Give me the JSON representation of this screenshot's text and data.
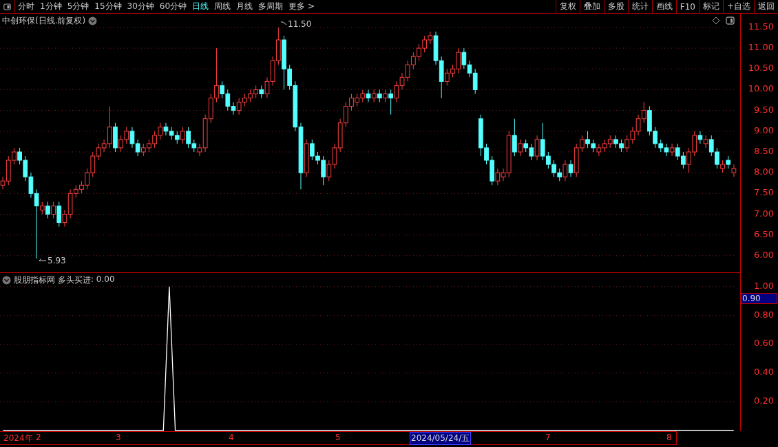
{
  "toolbar": {
    "periods": [
      {
        "label": "分时",
        "selected": false
      },
      {
        "label": "1分钟",
        "selected": false
      },
      {
        "label": "5分钟",
        "selected": false
      },
      {
        "label": "15分钟",
        "selected": false
      },
      {
        "label": "30分钟",
        "selected": false
      },
      {
        "label": "60分钟",
        "selected": false
      },
      {
        "label": "日线",
        "selected": true
      },
      {
        "label": "周线",
        "selected": false
      },
      {
        "label": "月线",
        "selected": false
      },
      {
        "label": "多周期",
        "selected": false
      },
      {
        "label": "更多 >",
        "selected": false
      }
    ],
    "actions": [
      "复权",
      "叠加",
      "多股",
      "统计",
      "画线",
      "F10",
      "标记",
      "+自选",
      "返回"
    ]
  },
  "price_pane": {
    "title": "中创环保(日线.前复权)",
    "high_label": "11.50",
    "low_label": "5.93",
    "chart_data": {
      "type": "candlestick",
      "grid": true,
      "ylim": [
        5.6,
        11.83
      ],
      "yticks": [
        {
          "value": 11.5,
          "label": "11.50"
        },
        {
          "value": 11,
          "label": "11.00"
        },
        {
          "value": 10.5,
          "label": "10.50"
        },
        {
          "value": 10,
          "label": "10.00"
        },
        {
          "value": 9.5,
          "label": "9.50"
        },
        {
          "value": 9,
          "label": "9.00"
        },
        {
          "value": 8.5,
          "label": "8.50"
        },
        {
          "value": 8,
          "label": "8.00"
        },
        {
          "value": 7.5,
          "label": "7.50"
        },
        {
          "value": 7,
          "label": "7.00"
        },
        {
          "value": 6.5,
          "label": "6.50"
        },
        {
          "value": 6,
          "label": "6.00"
        }
      ],
      "ohlc": [
        [
          7.7,
          7.9,
          7.6,
          7.8
        ],
        [
          7.8,
          8.4,
          7.7,
          8.3
        ],
        [
          8.3,
          8.6,
          8.2,
          8.5
        ],
        [
          8.5,
          8.6,
          8.2,
          8.3
        ],
        [
          8.3,
          8.4,
          7.8,
          7.9
        ],
        [
          7.9,
          8.0,
          7.4,
          7.5
        ],
        [
          7.5,
          7.6,
          5.93,
          7.2
        ],
        [
          7.1,
          7.3,
          7.0,
          7.2
        ],
        [
          7.2,
          7.3,
          6.9,
          7.0
        ],
        [
          7.0,
          7.3,
          6.9,
          7.2
        ],
        [
          7.2,
          7.3,
          6.7,
          6.8
        ],
        [
          6.8,
          7.1,
          6.7,
          7.0
        ],
        [
          7.0,
          7.6,
          6.9,
          7.5
        ],
        [
          7.5,
          7.7,
          7.4,
          7.6
        ],
        [
          7.6,
          7.8,
          7.5,
          7.7
        ],
        [
          7.7,
          8.1,
          7.6,
          8.0
        ],
        [
          8.0,
          8.5,
          7.9,
          8.4
        ],
        [
          8.4,
          8.7,
          8.3,
          8.6
        ],
        [
          8.6,
          8.8,
          8.5,
          8.7
        ],
        [
          8.7,
          9.6,
          8.6,
          9.1
        ],
        [
          9.1,
          9.2,
          8.5,
          8.6
        ],
        [
          8.6,
          8.9,
          8.5,
          8.8
        ],
        [
          8.8,
          9.1,
          8.7,
          9.0
        ],
        [
          9.0,
          9.1,
          8.6,
          8.7
        ],
        [
          8.7,
          8.8,
          8.4,
          8.5
        ],
        [
          8.5,
          8.7,
          8.4,
          8.6
        ],
        [
          8.6,
          8.8,
          8.5,
          8.7
        ],
        [
          8.7,
          9.0,
          8.6,
          8.9
        ],
        [
          8.9,
          9.2,
          8.8,
          9.1
        ],
        [
          9.1,
          9.2,
          8.9,
          9.0
        ],
        [
          9.0,
          9.1,
          8.8,
          8.9
        ],
        [
          8.9,
          9.0,
          8.7,
          8.8
        ],
        [
          8.8,
          9.1,
          8.7,
          9.0
        ],
        [
          9.0,
          9.1,
          8.6,
          8.7
        ],
        [
          8.7,
          8.8,
          8.5,
          8.6
        ],
        [
          8.5,
          8.7,
          8.4,
          8.6
        ],
        [
          8.6,
          9.4,
          8.5,
          9.3
        ],
        [
          9.3,
          9.9,
          9.2,
          9.8
        ],
        [
          9.8,
          11.0,
          9.7,
          10.1
        ],
        [
          10.1,
          10.2,
          9.8,
          9.9
        ],
        [
          9.9,
          10.0,
          9.5,
          9.6
        ],
        [
          9.6,
          9.7,
          9.4,
          9.5
        ],
        [
          9.5,
          9.8,
          9.4,
          9.7
        ],
        [
          9.7,
          9.9,
          9.6,
          9.8
        ],
        [
          9.8,
          10.0,
          9.7,
          9.9
        ],
        [
          9.9,
          10.1,
          9.8,
          10.0
        ],
        [
          10.0,
          10.1,
          9.8,
          9.9
        ],
        [
          9.9,
          10.3,
          9.8,
          10.2
        ],
        [
          10.2,
          10.8,
          10.1,
          10.7
        ],
        [
          10.7,
          11.5,
          10.6,
          11.2
        ],
        [
          11.2,
          11.3,
          10.0,
          10.5
        ],
        [
          10.5,
          10.6,
          10.0,
          10.1
        ],
        [
          10.1,
          10.2,
          9.0,
          9.1
        ],
        [
          9.1,
          9.2,
          7.6,
          8.0
        ],
        [
          8.0,
          8.8,
          7.9,
          8.7
        ],
        [
          8.7,
          8.8,
          8.3,
          8.4
        ],
        [
          8.4,
          8.5,
          8.2,
          8.3
        ],
        [
          8.3,
          8.4,
          7.7,
          7.9
        ],
        [
          7.9,
          8.3,
          7.8,
          8.2
        ],
        [
          8.2,
          8.7,
          8.1,
          8.6
        ],
        [
          8.6,
          9.3,
          8.5,
          9.2
        ],
        [
          9.2,
          9.7,
          9.1,
          9.6
        ],
        [
          9.6,
          9.9,
          9.5,
          9.8
        ],
        [
          9.7,
          9.9,
          9.6,
          9.8
        ],
        [
          9.8,
          10.0,
          9.7,
          9.9
        ],
        [
          9.9,
          10.0,
          9.7,
          9.8
        ],
        [
          9.8,
          10.0,
          9.7,
          9.9
        ],
        [
          9.9,
          10.0,
          9.7,
          9.8
        ],
        [
          9.8,
          10.0,
          9.7,
          9.9
        ],
        [
          9.9,
          10.0,
          9.4,
          9.8
        ],
        [
          9.8,
          10.2,
          9.7,
          10.1
        ],
        [
          10.1,
          10.4,
          10.0,
          10.3
        ],
        [
          10.3,
          10.7,
          10.2,
          10.6
        ],
        [
          10.6,
          10.9,
          10.5,
          10.8
        ],
        [
          10.8,
          11.1,
          10.7,
          11.0
        ],
        [
          11.0,
          11.3,
          10.9,
          11.2
        ],
        [
          11.2,
          11.4,
          11.1,
          11.3
        ],
        [
          11.3,
          11.4,
          10.6,
          10.7
        ],
        [
          10.7,
          10.8,
          9.8,
          10.2
        ],
        [
          10.2,
          10.5,
          10.1,
          10.4
        ],
        [
          10.4,
          10.6,
          10.3,
          10.5
        ],
        [
          10.5,
          11.0,
          10.4,
          10.9
        ],
        [
          10.9,
          11.0,
          10.5,
          10.6
        ],
        [
          10.6,
          10.7,
          10.3,
          10.4
        ],
        [
          10.4,
          10.5,
          9.9,
          10.0
        ],
        [
          9.3,
          9.4,
          8.4,
          8.6
        ],
        [
          8.6,
          8.7,
          8.2,
          8.3
        ],
        [
          8.3,
          8.4,
          7.7,
          7.8
        ],
        [
          7.8,
          8.1,
          7.7,
          8.0
        ],
        [
          7.9,
          8.1,
          7.8,
          8.0
        ],
        [
          8.0,
          9.0,
          7.9,
          8.9
        ],
        [
          8.9,
          9.3,
          8.4,
          8.5
        ],
        [
          8.5,
          8.8,
          8.4,
          8.7
        ],
        [
          8.7,
          8.8,
          8.5,
          8.6
        ],
        [
          8.6,
          8.7,
          8.3,
          8.4
        ],
        [
          8.4,
          8.9,
          8.3,
          8.8
        ],
        [
          8.8,
          9.2,
          8.3,
          8.4
        ],
        [
          8.4,
          8.5,
          8.1,
          8.2
        ],
        [
          8.2,
          8.3,
          7.9,
          8.0
        ],
        [
          8.0,
          8.1,
          7.8,
          7.9
        ],
        [
          7.9,
          8.3,
          7.8,
          8.2
        ],
        [
          8.2,
          8.3,
          7.9,
          8.0
        ],
        [
          8.0,
          8.7,
          7.9,
          8.6
        ],
        [
          8.6,
          8.9,
          8.5,
          8.8
        ],
        [
          8.8,
          9.0,
          8.6,
          8.7
        ],
        [
          8.7,
          8.8,
          8.5,
          8.6
        ],
        [
          8.5,
          8.7,
          8.4,
          8.6
        ],
        [
          8.6,
          8.8,
          8.5,
          8.7
        ],
        [
          8.7,
          8.9,
          8.6,
          8.8
        ],
        [
          8.8,
          8.9,
          8.6,
          8.7
        ],
        [
          8.7,
          8.8,
          8.5,
          8.6
        ],
        [
          8.6,
          8.9,
          8.5,
          8.8
        ],
        [
          8.8,
          9.1,
          8.7,
          9.0
        ],
        [
          9.0,
          9.4,
          8.9,
          9.3
        ],
        [
          9.3,
          9.7,
          9.2,
          9.5
        ],
        [
          9.5,
          9.6,
          8.9,
          9.0
        ],
        [
          9.0,
          9.1,
          8.6,
          8.7
        ],
        [
          8.7,
          8.8,
          8.5,
          8.6
        ],
        [
          8.6,
          8.7,
          8.4,
          8.5
        ],
        [
          8.5,
          8.7,
          8.4,
          8.6
        ],
        [
          8.6,
          8.7,
          8.3,
          8.4
        ],
        [
          8.4,
          8.5,
          8.1,
          8.2
        ],
        [
          8.2,
          8.6,
          8.0,
          8.5
        ],
        [
          8.5,
          9.0,
          8.4,
          8.9
        ],
        [
          8.9,
          9.0,
          8.7,
          8.8
        ],
        [
          8.7,
          8.9,
          8.6,
          8.8
        ],
        [
          8.8,
          8.9,
          8.4,
          8.5
        ],
        [
          8.5,
          8.6,
          8.1,
          8.2
        ],
        [
          8.1,
          8.3,
          8.0,
          8.2
        ],
        [
          8.3,
          8.4,
          8.1,
          8.2
        ],
        [
          8.0,
          8.2,
          7.9,
          8.1
        ]
      ]
    }
  },
  "indicator_pane": {
    "source": "股朋指标网",
    "reading": ": 0.00",
    "cursor_value": "0.90",
    "chart_data": {
      "type": "line",
      "grid": true,
      "ylim": [
        0,
        1.09
      ],
      "yticks": [
        {
          "value": 1,
          "label": "1.00"
        },
        {
          "value": 0.8,
          "label": "0.80"
        },
        {
          "value": 0.6,
          "label": "0.60"
        },
        {
          "value": 0.4,
          "label": "0.40"
        },
        {
          "value": 0.2,
          "label": "0.20"
        }
      ],
      "series": [
        {
          "name": "多头买进",
          "color": "#ffffff",
          "values": [
            0,
            0,
            0,
            0,
            0,
            0,
            0,
            0,
            0,
            0,
            0,
            0,
            0,
            0,
            0,
            0,
            0,
            0,
            0,
            0,
            0,
            0,
            0,
            0,
            0,
            0,
            0,
            0,
            1,
            0,
            0,
            0,
            0,
            0,
            0,
            0,
            0,
            0,
            0,
            0,
            0,
            0,
            0,
            0,
            0,
            0,
            0,
            0,
            0,
            0,
            0,
            0,
            0,
            0,
            0,
            0,
            0,
            0,
            0,
            0,
            0,
            0,
            0,
            0,
            0,
            0,
            0,
            0,
            0,
            0,
            0,
            0,
            0,
            0,
            0,
            0,
            0,
            0,
            0,
            0,
            0,
            0,
            0,
            0,
            0,
            0,
            0,
            0,
            0,
            0,
            0,
            0,
            0,
            0,
            0,
            0,
            0,
            0,
            0,
            0,
            0,
            0,
            0,
            0,
            0,
            0,
            0,
            0,
            0,
            0,
            0,
            0,
            0,
            0,
            0,
            0,
            0,
            0,
            0,
            0,
            0,
            0,
            0,
            0
          ]
        }
      ]
    }
  },
  "time_axis": {
    "labels": [
      "2024年",
      "2",
      "3",
      "4",
      "5",
      "7",
      "8"
    ],
    "cursor_date": "2024/05/24/五"
  }
}
